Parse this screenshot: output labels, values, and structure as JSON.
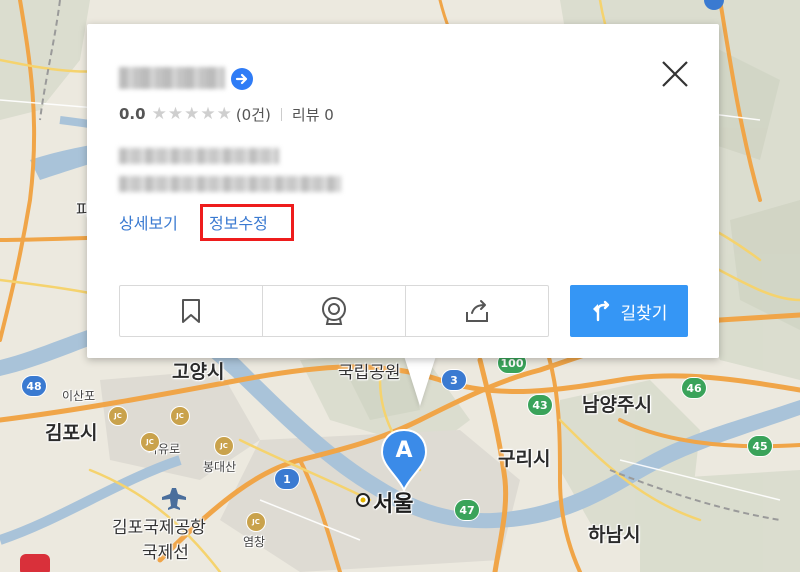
{
  "popup": {
    "rating": {
      "score": "0.0",
      "count": "(0건)",
      "review": "리뷰 0"
    },
    "links": {
      "detail": "상세보기",
      "edit": "정보수정"
    },
    "route_label": "길찾기"
  },
  "map": {
    "places": {
      "goyang": "고양시",
      "gimpo": "김포시",
      "isanpo": "이산포",
      "jayuro": "자유로",
      "bongdaesan": "봉대산",
      "airport": "김포국제공항",
      "airport_line": "국제선",
      "yeomchang": "염창",
      "seoul": "서울",
      "national_park": "국립공원",
      "namyangju": "남양주시",
      "guri": "구리시",
      "hanam": "하남시",
      "pa_partial": "파"
    },
    "shields": [
      "48",
      "1",
      "3",
      "100",
      "43",
      "46",
      "45",
      "47"
    ],
    "jc_label": "JC",
    "marker_label": "A"
  }
}
